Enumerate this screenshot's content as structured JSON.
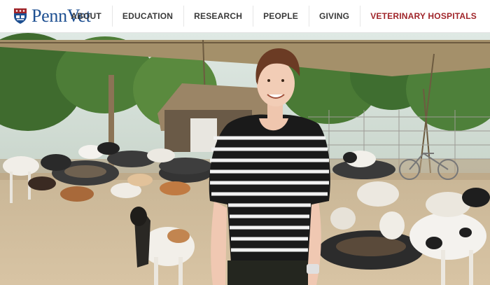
{
  "header": {
    "logo_text": "PennVet",
    "logo_icon": "penn-shield-icon"
  },
  "nav": {
    "items": [
      {
        "label": "ABOUT"
      },
      {
        "label": "EDUCATION"
      },
      {
        "label": "RESEARCH"
      },
      {
        "label": "PEOPLE"
      },
      {
        "label": "GIVING"
      },
      {
        "label": "VETERINARY HOSPITALS",
        "highlight": true
      }
    ]
  },
  "hero": {
    "image_description_icon": "hero-photo"
  },
  "colors": {
    "brand_blue": "#1d4f91",
    "brand_red": "#a0252a",
    "nav_text": "#3a3a3a"
  }
}
